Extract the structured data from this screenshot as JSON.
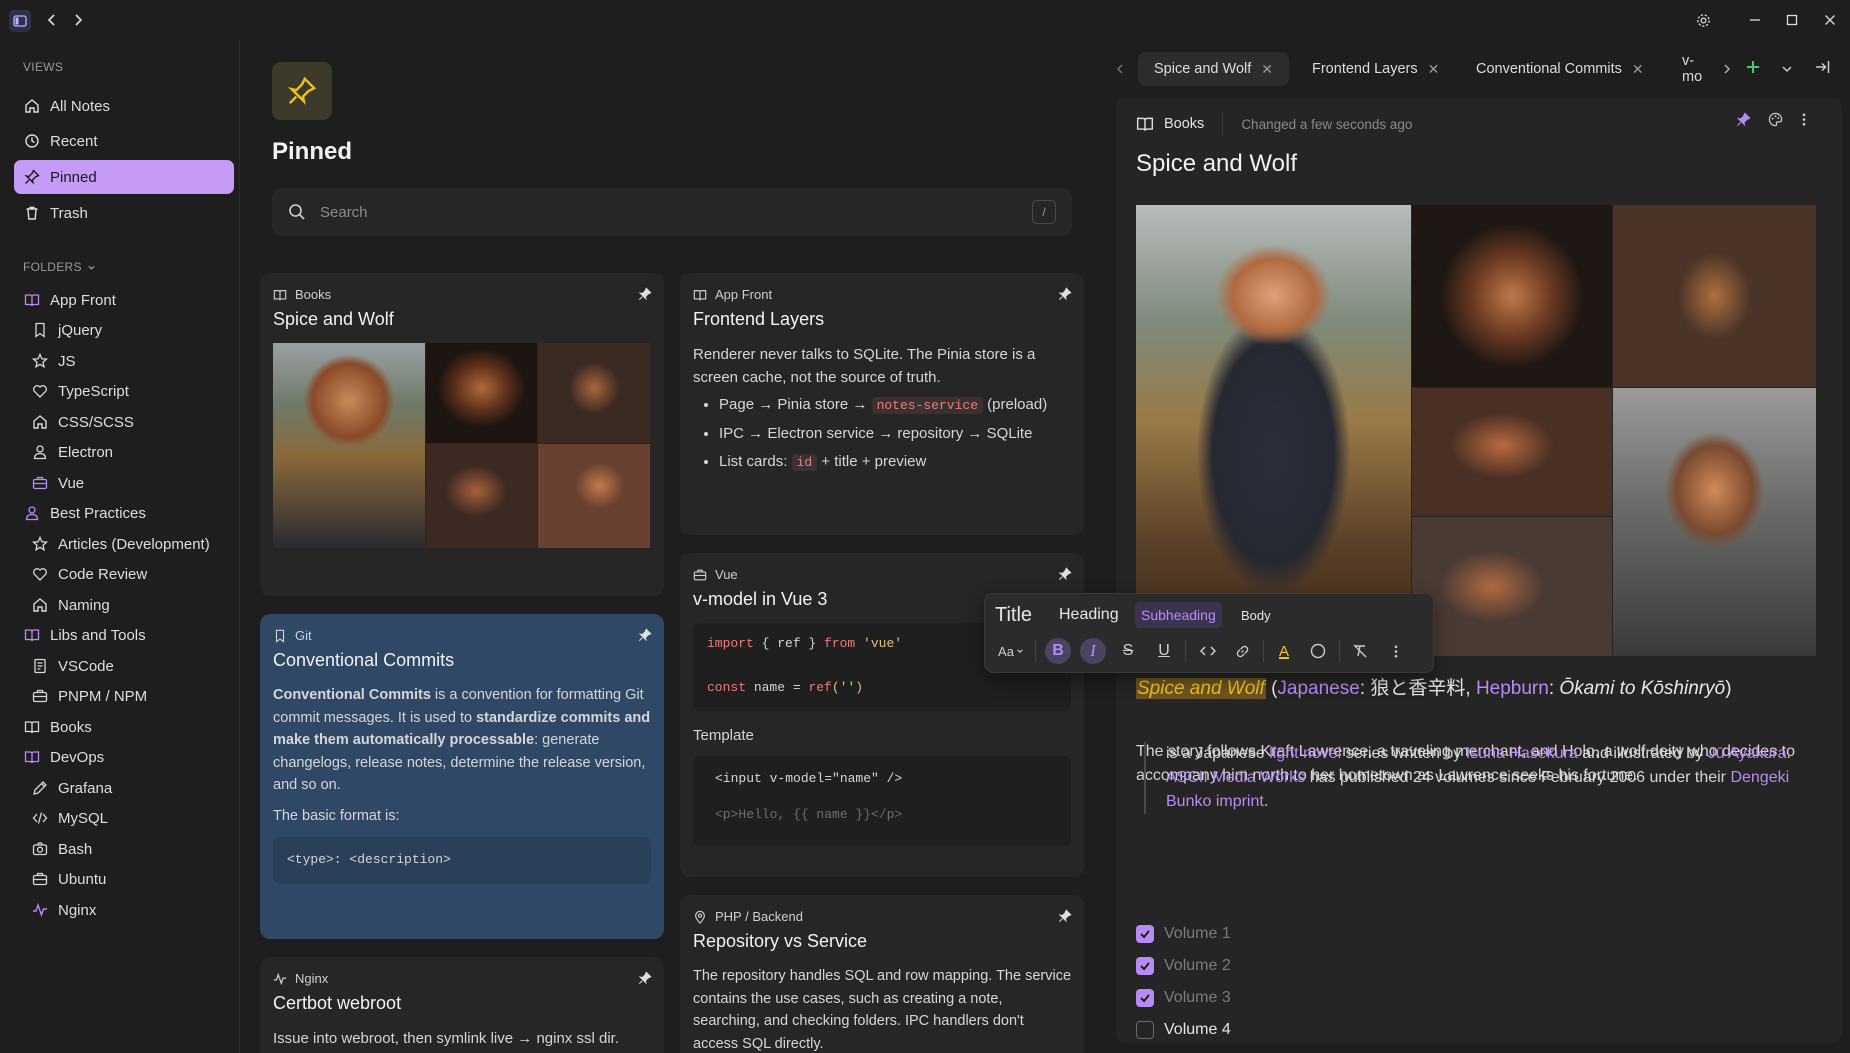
{
  "sidebar": {
    "views_label": "VIEWS",
    "views": [
      {
        "label": "All Notes",
        "icon": "home-icon"
      },
      {
        "label": "Recent",
        "icon": "clock-icon"
      },
      {
        "label": "Pinned",
        "icon": "pin-icon",
        "active": true
      },
      {
        "label": "Trash",
        "icon": "trash-icon"
      }
    ],
    "folders_label": "FOLDERS",
    "folders": [
      {
        "label": "App Front",
        "icon": "book-icon",
        "level": 0,
        "accent": true
      },
      {
        "label": "jQuery",
        "icon": "bookmark-icon",
        "level": 1
      },
      {
        "label": "JS",
        "icon": "star-icon",
        "level": 1
      },
      {
        "label": "TypeScript",
        "icon": "heart-icon",
        "level": 1
      },
      {
        "label": "CSS/SCSS",
        "icon": "home-icon",
        "level": 1
      },
      {
        "label": "Electron",
        "icon": "user-icon",
        "level": 1
      },
      {
        "label": "Vue",
        "icon": "briefcase-icon",
        "level": 1,
        "accent": true
      },
      {
        "label": "Best Practices",
        "icon": "user-icon",
        "level": 0,
        "accent": true
      },
      {
        "label": "Articles (Development)",
        "icon": "star-icon",
        "level": 1
      },
      {
        "label": "Code Review",
        "icon": "heart-icon",
        "level": 1
      },
      {
        "label": "Naming",
        "icon": "home-icon",
        "level": 1
      },
      {
        "label": "Libs and Tools",
        "icon": "book-icon",
        "level": 0,
        "accent": true
      },
      {
        "label": "VSCode",
        "icon": "note-icon",
        "level": 1
      },
      {
        "label": "PNPM / NPM",
        "icon": "briefcase-icon",
        "level": 1
      },
      {
        "label": "Books",
        "icon": "book-icon",
        "level": 0
      },
      {
        "label": "DevOps",
        "icon": "book-icon",
        "level": 0,
        "accent": true
      },
      {
        "label": "Grafana",
        "icon": "pencil-icon",
        "level": 1
      },
      {
        "label": "MySQL",
        "icon": "code-icon",
        "level": 1
      },
      {
        "label": "Bash",
        "icon": "camera-icon",
        "level": 1
      },
      {
        "label": "Ubuntu",
        "icon": "briefcase-icon",
        "level": 1
      },
      {
        "label": "Nginx",
        "icon": "pulse-icon",
        "level": 1,
        "accent": true
      }
    ]
  },
  "center": {
    "title": "Pinned",
    "search_placeholder": "Search",
    "search_shortcut": "/",
    "cards": {
      "spice": {
        "folder": "Books",
        "title": "Spice and Wolf"
      },
      "frontend": {
        "folder": "App Front",
        "title": "Frontend Layers",
        "text": "Renderer never talks to SQLite. The Pinia store is a screen cache, not the source of truth.",
        "b1_pre": "Page → Pinia store → ",
        "b1_code": "notes-service",
        "b1_post": " (preload)",
        "b2": "IPC → Electron service → repository → SQLite",
        "b3_pre": "List cards: ",
        "b3_code": "id",
        "b3_post": " + title + preview"
      },
      "commits": {
        "folder": "Git",
        "title": "Conventional Commits",
        "p1_b1": "Conventional Commits",
        "p1_t1": " is a convention for formatting Git commit messages. It is used to ",
        "p1_b2": "standardize commits and make them automatically processable",
        "p1_t2": ": generate changelogs, release notes, determine the release version, and so on.",
        "p2": "The basic format is:",
        "code": "<type>: <description>"
      },
      "vue": {
        "folder": "Vue",
        "title": "v-model in Vue 3",
        "code_import": "import",
        "code_ref": " { ref } ",
        "code_from": "from",
        "code_mod": " 'vue'",
        "code_const": "const",
        "code_name": " name = ",
        "code_call": "ref",
        "code_arg": "('')",
        "template_label": "Template",
        "tpl_line1": "<input v-model=\"name\" />",
        "tpl_line2": "<p>Hello, {{ name }}</p>"
      },
      "php": {
        "folder": "PHP / Backend",
        "title": "Repository vs Service",
        "text": "The repository handles SQL and row mapping. The service contains the use cases, such as creating a note, searching, and checking folders. IPC handlers don't access SQL directly."
      },
      "nginx": {
        "folder": "Nginx",
        "title": "Certbot webroot",
        "text": "Issue into webroot, then symlink live → nginx ssl dir."
      }
    }
  },
  "tabs": [
    {
      "label": "Spice and Wolf",
      "active": true
    },
    {
      "label": "Frontend Layers"
    },
    {
      "label": "Conventional Commits"
    },
    {
      "label": "v-mo"
    }
  ],
  "editor": {
    "folder": "Books",
    "changed": "Changed a few seconds ago",
    "title": "Spice and Wolf",
    "toolbar": {
      "title": "Title",
      "heading": "Heading",
      "subheading": "Subheading",
      "body": "Body",
      "size_label": "Aa"
    },
    "sub": {
      "highlight": "Spice and Wolf",
      "p1": " (",
      "link1": "Japanese",
      "p2": ": 狼と香辛料, ",
      "link2": "Hepburn",
      "p3": ": ",
      "italic": "Ōkami to Kōshinryō",
      "p4": ")"
    },
    "quote": {
      "t1": "is a Japanese ",
      "l1": "light novel",
      "t2": " series written by ",
      "l2": "Isuna Hasekura",
      "t3": " and illustrated by ",
      "l3": "Jū Ayakura",
      "t4": ". ",
      "l4": "ASCII Media Works",
      "t5": " has published 24 volumes since February 2006 under their ",
      "l5": "Dengeki Bunko imprint",
      "t6": "."
    },
    "story": "The story follows Kraft Lawrence, a traveling merchant, and Holo, a wolf deity who decides to accompany him north to her hometown as Lawrence seeks his fortune.",
    "checklist": [
      {
        "label": "Volume 1",
        "checked": true
      },
      {
        "label": "Volume 2",
        "checked": true
      },
      {
        "label": "Volume 3",
        "checked": true
      },
      {
        "label": "Volume 4",
        "checked": false
      }
    ]
  },
  "colors": {
    "accent": "#b88af5",
    "pinned_bg": "#c59bf7",
    "selected_card": "#2f4866",
    "pin_yellow": "#f0c020"
  }
}
